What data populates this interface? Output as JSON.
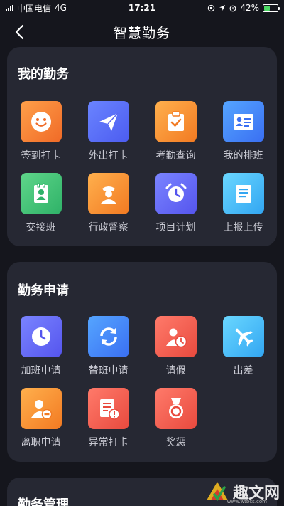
{
  "status_bar": {
    "carrier": "中国电信",
    "network": "4G",
    "time": "17:21",
    "battery": "42%",
    "battery_level": 0.42
  },
  "nav": {
    "title": "智慧勤务"
  },
  "sections": [
    {
      "title": "我的勤务",
      "items": [
        {
          "label": "签到打卡",
          "icon": "smile-icon",
          "color": "#f4772b"
        },
        {
          "label": "外出打卡",
          "icon": "paper-plane-icon",
          "color": "#5866f2"
        },
        {
          "label": "考勤查询",
          "icon": "clipboard-check-icon",
          "color": "#f38b2c"
        },
        {
          "label": "我的排班",
          "icon": "id-card-icon",
          "color": "#4a7ef4"
        },
        {
          "label": "交接班",
          "icon": "contact-book-icon",
          "color": "#3cbf72"
        },
        {
          "label": "行政督察",
          "icon": "officer-icon",
          "color": "#f3952e"
        },
        {
          "label": "项目计划",
          "icon": "alarm-clock-icon",
          "color": "#6166f2"
        },
        {
          "label": "上报上传",
          "icon": "document-icon",
          "color": "#3fb5f3"
        }
      ]
    },
    {
      "title": "勤务申请",
      "items": [
        {
          "label": "加班申请",
          "icon": "clock-icon",
          "color": "#5d66f0"
        },
        {
          "label": "替班申请",
          "icon": "refresh-icon",
          "color": "#3f7ff2"
        },
        {
          "label": "请假",
          "icon": "user-clock-icon",
          "color": "#ec5a44"
        },
        {
          "label": "出差",
          "icon": "airplane-icon",
          "color": "#43b5f3"
        },
        {
          "label": "离职申请",
          "icon": "user-minus-icon",
          "color": "#f3952e"
        },
        {
          "label": "异常打卡",
          "icon": "alert-document-icon",
          "color": "#ec5a44"
        },
        {
          "label": "奖惩",
          "icon": "medal-icon",
          "color": "#ec5a44"
        }
      ]
    },
    {
      "title": "勤务管理",
      "items": []
    }
  ],
  "watermark": {
    "text": "趣文网",
    "url": "www.wtbcs.com"
  }
}
